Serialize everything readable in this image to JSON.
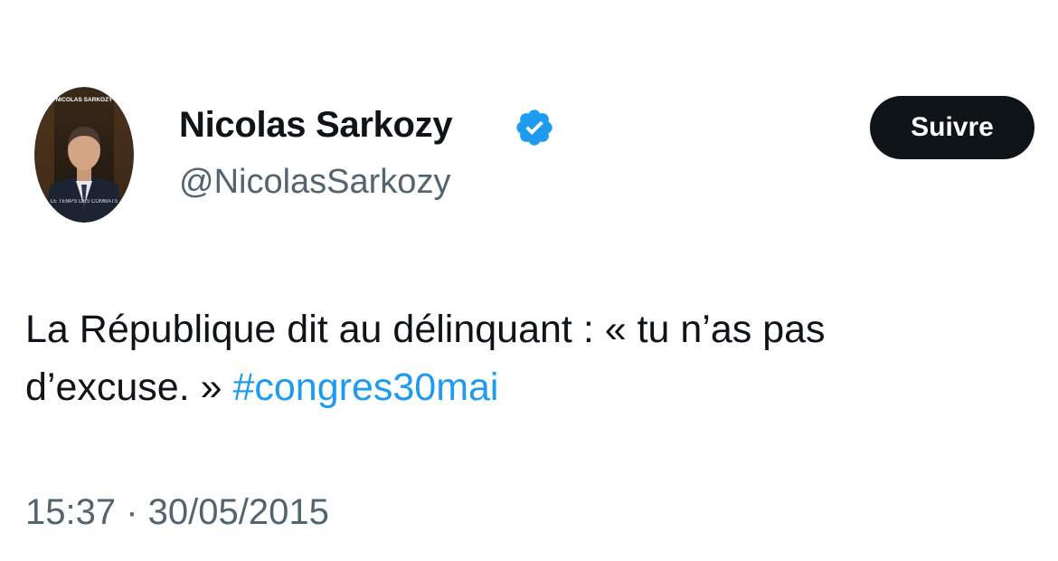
{
  "author": {
    "display_name": "Nicolas Sarkozy",
    "handle": "@NicolasSarkozy",
    "verified": true,
    "avatar_text_top": "NICOLAS SARKOZY",
    "avatar_text_bottom": "LE TEMPS DES COMBATS"
  },
  "follow_button": {
    "label": "Suivre"
  },
  "tweet": {
    "line1": "La République dit au délinquant : «  tu n’as pas",
    "line2_prefix": "d’excuse. » ",
    "hashtag": "#congres30mai"
  },
  "meta": {
    "time": "15:37",
    "separator": " · ",
    "date": "30/05/2015"
  },
  "colors": {
    "accent": "#1d9bf0",
    "text": "#0f1419",
    "secondary": "#536471",
    "button_bg": "#0f1419",
    "button_text": "#ffffff"
  }
}
